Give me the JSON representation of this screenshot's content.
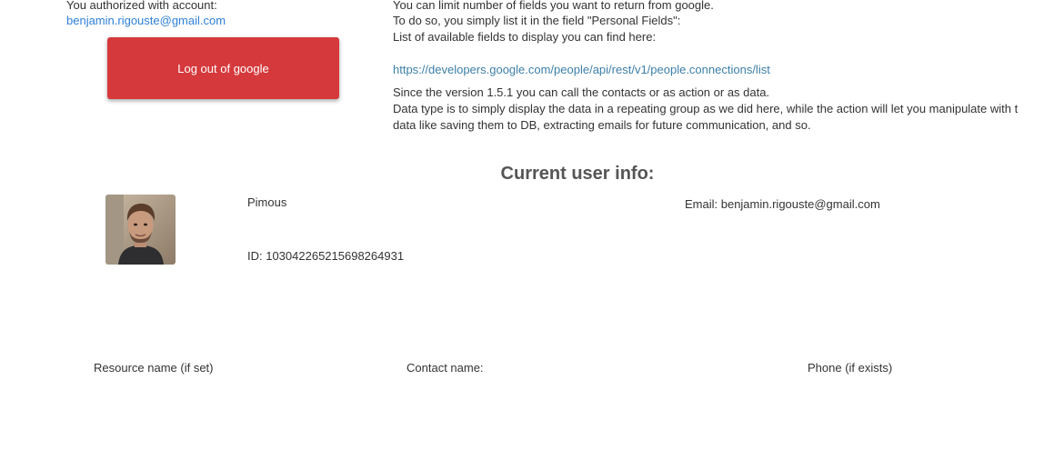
{
  "account": {
    "label": "You authorized with account:",
    "email": "benjamin.rigouste@gmail.com",
    "logout_label": "Log out of google"
  },
  "info": {
    "line1": "You can limit number of fields you want to return from google.",
    "line2": "To do so, you simply list it in the field \"Personal Fields\":",
    "line3": "List of available fields to display you can find here:",
    "link": "https://developers.google.com/people/api/rest/v1/people.connections/list",
    "line4": "Since the version 1.5.1 you can call the contacts or as action or as data.",
    "line5": "Data type is to simply display the data in a repeating group as we did here, while the action will let you manipulate with t",
    "line6": "data like saving them to DB, extracting emails for future communication, and so."
  },
  "current_user": {
    "title": "Current user info:",
    "name": "Pimous",
    "id": "ID: 103042265215698264931",
    "email": "Email: benjamin.rigouste@gmail.com"
  },
  "contacts": {
    "columns": [
      "Resource name (if set)",
      "Contact name:",
      "Phone (if exists)"
    ]
  },
  "colors": {
    "button": "#d5393c",
    "link": "#2f80d8",
    "text": "#333333"
  }
}
